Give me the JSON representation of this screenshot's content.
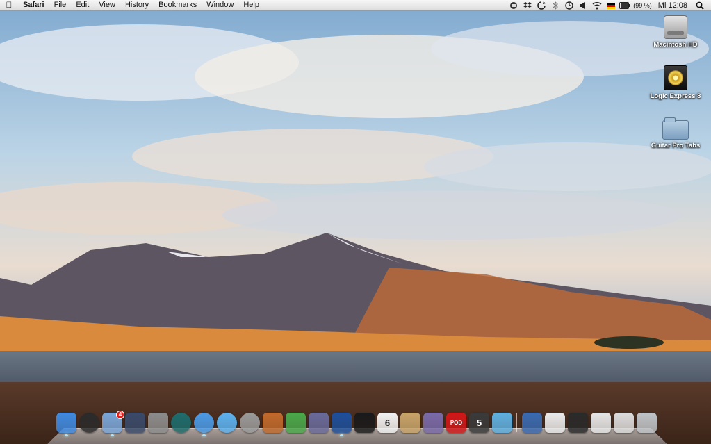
{
  "menubar": {
    "apple_glyph": "",
    "app_name": "Safari",
    "menus": [
      "File",
      "Edit",
      "View",
      "History",
      "Bookmarks",
      "Window",
      "Help"
    ],
    "status_icons": [
      "script-menu-icon",
      "dropbox-icon",
      "sync-icon",
      "bluetooth-icon",
      "time-machine-icon",
      "volume-icon",
      "wifi-icon",
      "german-flag-icon",
      "battery-icon"
    ],
    "battery_percent": "(99 %)",
    "clock": "Mi 12:08",
    "spotlight_icon": "spotlight-search-icon"
  },
  "desktop": {
    "icons": [
      {
        "label": "Macintosh HD",
        "icon": "hard-drive-icon"
      },
      {
        "label": "Logic Express 8",
        "icon": "logic-express-icon"
      },
      {
        "label": "Guitar Pro Tabs",
        "icon": "folder-icon"
      }
    ]
  },
  "dock": {
    "items": [
      {
        "name": "finder",
        "icon": "finder-icon",
        "running": true,
        "color": "#3f8ae0"
      },
      {
        "name": "dashboard",
        "icon": "dashboard-icon",
        "running": false,
        "color": "#2b2b2b"
      },
      {
        "name": "mail",
        "icon": "mail-icon",
        "running": true,
        "badge": "4",
        "color": "#7aa6d8"
      },
      {
        "name": "spaces",
        "icon": "spaces-icon",
        "running": false,
        "color": "#3a4a6a"
      },
      {
        "name": "system-preferences",
        "icon": "system-preferences-icon",
        "running": false,
        "color": "#8c8c8c"
      },
      {
        "name": "time-machine",
        "icon": "time-machine-icon",
        "running": false,
        "color": "#1d6d6d"
      },
      {
        "name": "safari",
        "icon": "safari-icon",
        "running": true,
        "color": "#4b9ae6"
      },
      {
        "name": "itunes",
        "icon": "itunes-icon",
        "running": false,
        "color": "#5cb2f0"
      },
      {
        "name": "software-update",
        "icon": "software-update-icon",
        "running": false,
        "color": "#9a9a9a"
      },
      {
        "name": "keynote",
        "icon": "keynote-icon",
        "running": false,
        "color": "#c06a2c"
      },
      {
        "name": "numbers",
        "icon": "numbers-icon",
        "running": false,
        "color": "#4aa84a"
      },
      {
        "name": "script-editor",
        "icon": "script-editor-icon",
        "running": false,
        "color": "#6a6a9a"
      },
      {
        "name": "cyberduck",
        "icon": "cyberduck-icon",
        "running": true,
        "color": "#1e4f9a"
      },
      {
        "name": "logic-express",
        "icon": "logic-express-icon",
        "running": false,
        "color": "#1a1a1a"
      },
      {
        "name": "ical",
        "icon": "ical-icon",
        "running": false,
        "color": "#f2f2f2",
        "text": "6"
      },
      {
        "name": "address-book",
        "icon": "address-book-icon",
        "running": false,
        "color": "#c8a46a"
      },
      {
        "name": "garageband",
        "icon": "guitar-icon",
        "running": false,
        "color": "#7a6aa8"
      },
      {
        "name": "pod",
        "icon": "pod-icon",
        "running": false,
        "color": "#d01818",
        "text": "POD"
      },
      {
        "name": "guitar-pro",
        "icon": "guitar-pro-icon",
        "running": false,
        "color": "#3a3a3a",
        "text": "5"
      },
      {
        "name": "fish",
        "icon": "fish-icon",
        "running": false,
        "color": "#5fb0e0"
      },
      {
        "name": "user-folder",
        "icon": "user-home-icon",
        "running": false,
        "color": "#3a6ab0"
      },
      {
        "name": "document",
        "icon": "document-icon",
        "running": false,
        "color": "#eaeaea"
      },
      {
        "name": "documents-stack",
        "icon": "documents-stack-icon",
        "running": false,
        "color": "#2a2a2a"
      },
      {
        "name": "downloads-stack",
        "icon": "downloads-stack-icon",
        "running": false,
        "color": "#e6e6e6"
      },
      {
        "name": "preview-stack",
        "icon": "preview-stack-icon",
        "running": false,
        "color": "#dcdcdc"
      },
      {
        "name": "trash",
        "icon": "trash-icon",
        "running": false,
        "color": "#bfc3c7"
      }
    ]
  }
}
